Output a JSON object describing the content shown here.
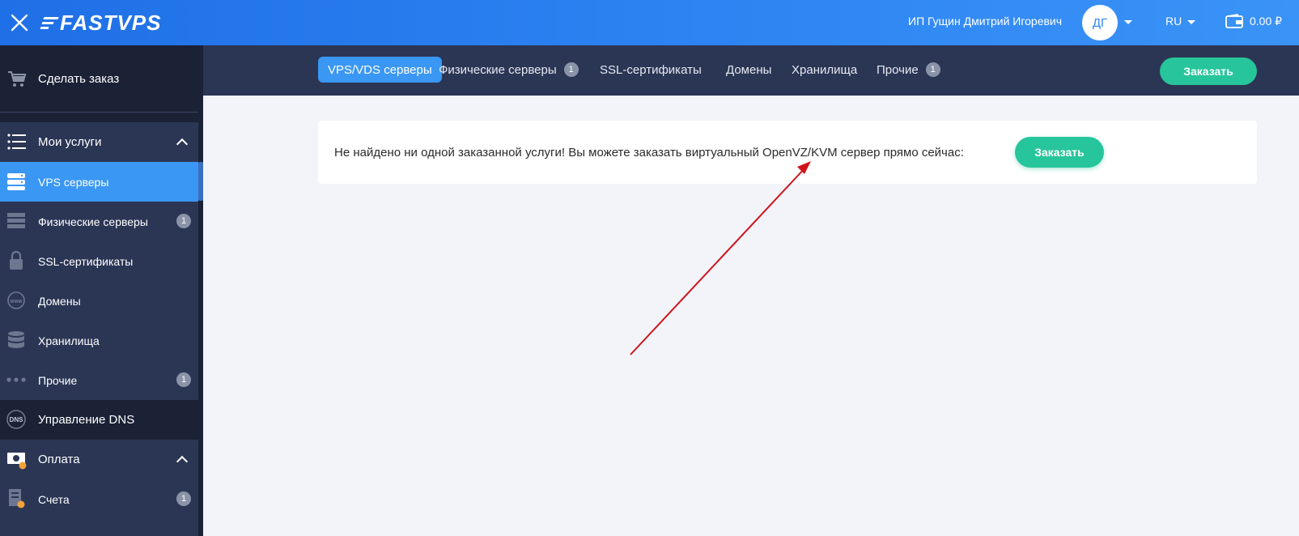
{
  "header": {
    "logo_text": "FASTVPS",
    "user_name": "ИП Гущин Дмитрий Игоревич",
    "avatar_initials": "ДГ",
    "language": "RU",
    "balance": "0.00 ₽"
  },
  "sidebar": {
    "make_order": "Сделать заказ",
    "my_services": "Мои услуги",
    "items": [
      {
        "label": "VPS серверы",
        "badge": ""
      },
      {
        "label": "Физические серверы",
        "badge": "1"
      },
      {
        "label": "SSL-сертификаты",
        "badge": ""
      },
      {
        "label": "Домены",
        "badge": ""
      },
      {
        "label": "Хранилища",
        "badge": ""
      },
      {
        "label": "Прочие",
        "badge": "1"
      }
    ],
    "dns": "Управление DNS",
    "dns_icon_text": "DNS",
    "payment": "Оплата",
    "invoices": {
      "label": "Счета",
      "badge": "1"
    }
  },
  "tabs": [
    {
      "label": "VPS/VDS серверы",
      "badge": ""
    },
    {
      "label": "Физические серверы",
      "badge": "1"
    },
    {
      "label": "SSL-сертификаты",
      "badge": ""
    },
    {
      "label": "Домены",
      "badge": ""
    },
    {
      "label": "Хранилища",
      "badge": ""
    },
    {
      "label": "Прочие",
      "badge": "1"
    }
  ],
  "order_button": "Заказать",
  "notice": {
    "text": "Не найдено ни одной заказанной услуги!  Вы можете заказать виртуальный OpenVZ/KVM сервер прямо сейчас:",
    "button": "Заказать"
  },
  "colors": {
    "topbar": "#2f86f3",
    "sidebar": "#2b3655",
    "accent": "#3a97f3",
    "order_green": "#27c59b",
    "annotation_arrow": "#d0131a"
  }
}
